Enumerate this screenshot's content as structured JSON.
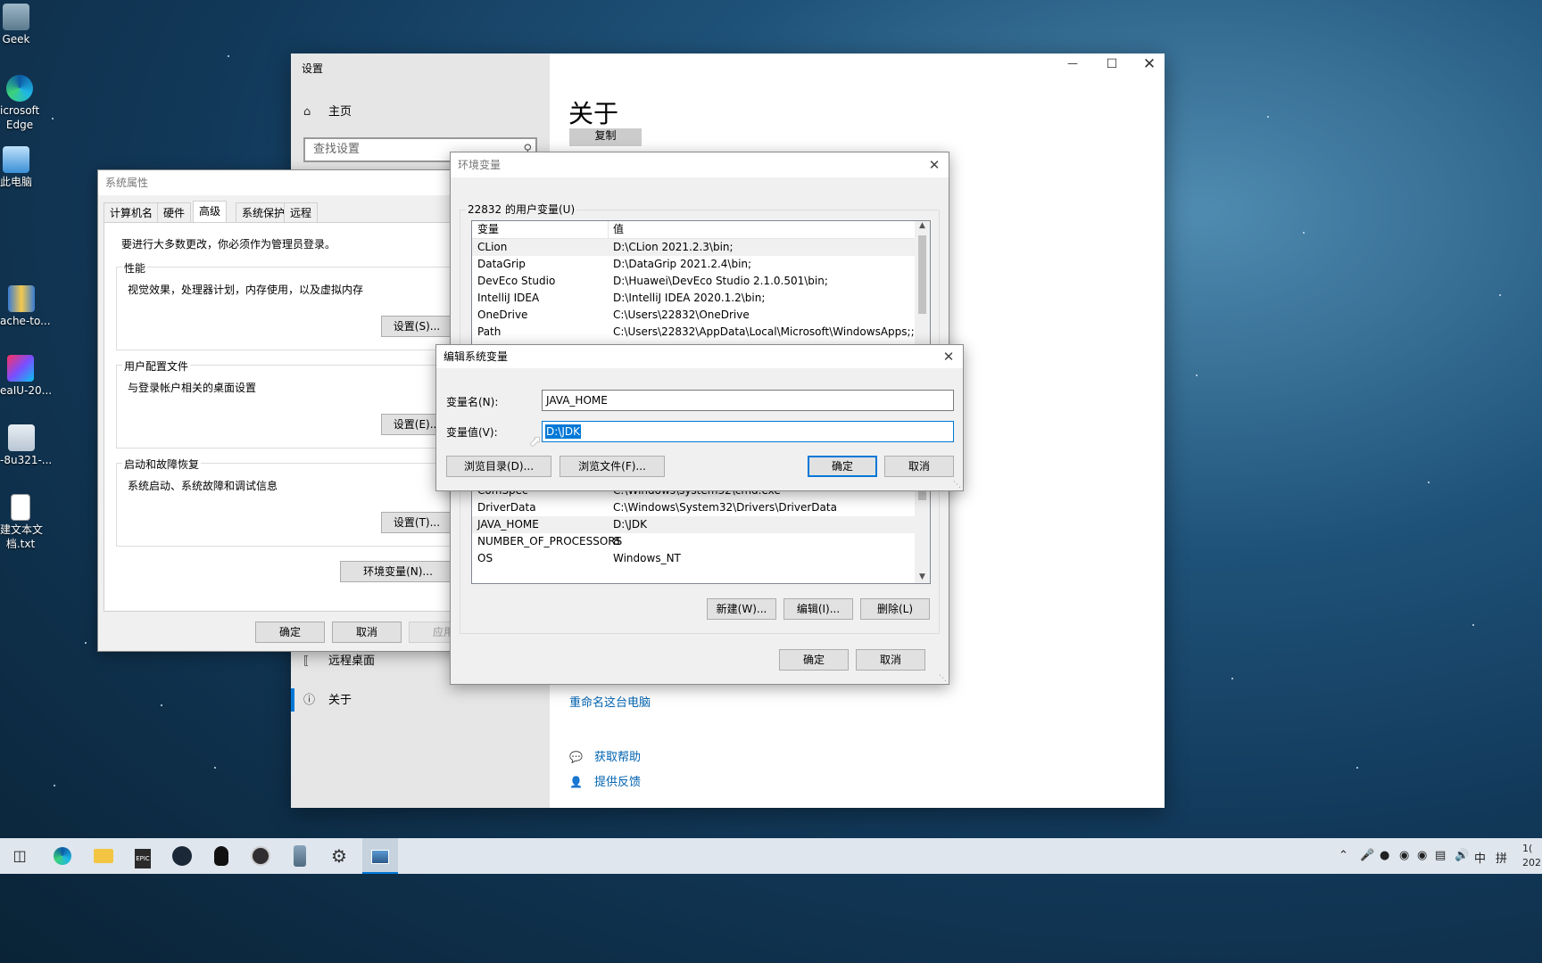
{
  "desktop": {
    "icons": [
      {
        "label": "Geek",
        "icon": "geek-uninstaller-icon"
      },
      {
        "label": "icrosoft\nEdge",
        "icon": "edge-icon"
      },
      {
        "label": "此电脑",
        "icon": "this-pc-icon"
      },
      {
        "label": "ache-to...",
        "icon": "archive-icon"
      },
      {
        "label": "eaIU-20...",
        "icon": "intellij-icon"
      },
      {
        "label": "-8u321-...",
        "icon": "java-installer-icon"
      },
      {
        "label": "建文本文\n档.txt",
        "icon": "text-file-icon"
      }
    ]
  },
  "settings": {
    "window_title": "设置",
    "home": "主页",
    "search_placeholder": "查找设置",
    "nav_remote": "远程桌面",
    "nav_about": "关于",
    "page_title": "关于",
    "copy_button": "复制",
    "rename_link": "重命名这台电脑",
    "help_link": "获取帮助",
    "feedback_link": "提供反馈"
  },
  "sysprops": {
    "title": "系统属性",
    "tabs": [
      "计算机名",
      "硬件",
      "高级",
      "系统保护",
      "远程"
    ],
    "admin_note": "要进行大多数更改，你必须作为管理员登录。",
    "perf_label": "性能",
    "perf_desc": "视觉效果，处理器计划，内存使用，以及虚拟内存",
    "perf_btn": "设置(S)...",
    "profile_label": "用户配置文件",
    "profile_desc": "与登录帐户相关的桌面设置",
    "profile_btn": "设置(E)...",
    "startup_label": "启动和故障恢复",
    "startup_desc": "系统启动、系统故障和调试信息",
    "startup_btn": "设置(T)...",
    "env_btn": "环境变量(N)...",
    "ok": "确定",
    "cancel": "取消",
    "apply": "应用"
  },
  "envvars": {
    "title": "环境变量",
    "user_label": "22832 的用户变量(U)",
    "col_var": "变量",
    "col_val": "值",
    "user_rows": [
      {
        "name": "CLion",
        "value": "D:\\CLion 2021.2.3\\bin;"
      },
      {
        "name": "DataGrip",
        "value": "D:\\DataGrip 2021.2.4\\bin;"
      },
      {
        "name": "DevEco Studio",
        "value": "D:\\Huawei\\DevEco Studio 2.1.0.501\\bin;"
      },
      {
        "name": "IntelliJ IDEA",
        "value": "D:\\IntelliJ IDEA 2020.1.2\\bin;"
      },
      {
        "name": "OneDrive",
        "value": "C:\\Users\\22832\\OneDrive"
      },
      {
        "name": "Path",
        "value": "C:\\Users\\22832\\AppData\\Local\\Microsoft\\WindowsApps;;D:\\..."
      }
    ],
    "sys_rows": [
      {
        "name": "ComSpec",
        "value": "C:\\Windows\\system32\\cmd.exe"
      },
      {
        "name": "DriverData",
        "value": "C:\\Windows\\System32\\Drivers\\DriverData"
      },
      {
        "name": "JAVA_HOME",
        "value": "D:\\JDK"
      },
      {
        "name": "NUMBER_OF_PROCESSORS",
        "value": "8"
      },
      {
        "name": "OS",
        "value": "Windows_NT"
      }
    ],
    "new_btn": "新建(W)...",
    "edit_btn": "编辑(I)...",
    "delete_btn": "删除(L)",
    "ok": "确定",
    "cancel": "取消"
  },
  "editdlg": {
    "title": "编辑系统变量",
    "name_label": "变量名(N):",
    "name_value": "JAVA_HOME",
    "value_label": "变量值(V):",
    "value_value": "D:\\JDK",
    "browse_dir": "浏览目录(D)...",
    "browse_file": "浏览文件(F)...",
    "ok": "确定",
    "cancel": "取消"
  },
  "taskbar": {
    "apps": [
      "task-view-icon",
      "edge-icon",
      "file-explorer-icon",
      "epic-games-icon",
      "steam-icon",
      "qq-icon",
      "obs-icon",
      "archive-icon",
      "settings-gear-icon",
      "system-properties-icon"
    ],
    "ime": "中",
    "ime2": "拼",
    "clock_line1": "1(",
    "clock_line2": "202"
  },
  "colors": {
    "accent": "#0078d7",
    "selection": "#0078d7",
    "link": "#0063b1"
  }
}
